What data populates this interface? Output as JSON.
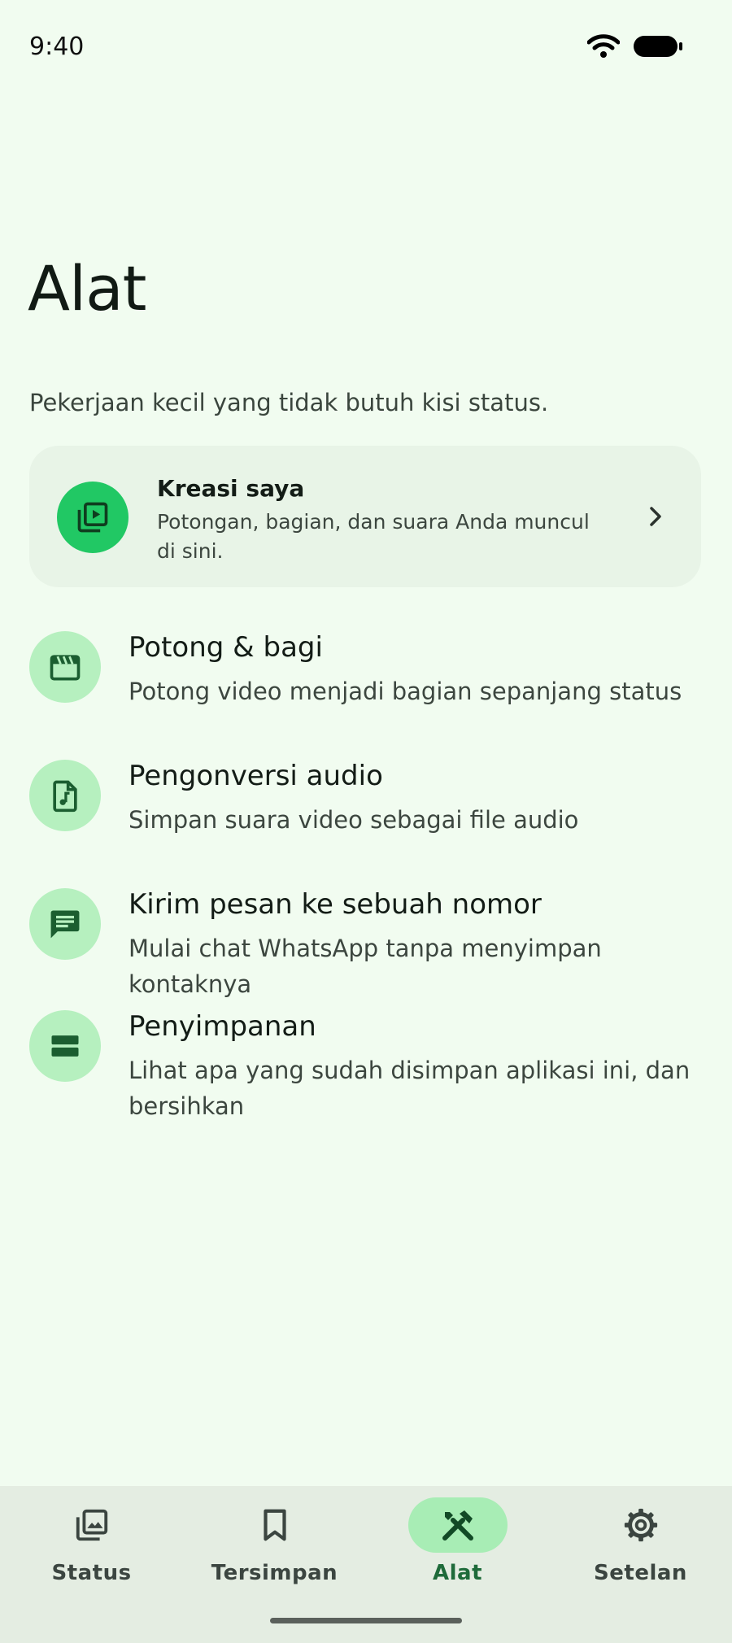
{
  "status_bar": {
    "time": "9:40",
    "icons": [
      "wifi-icon",
      "battery-icon"
    ]
  },
  "page": {
    "title": "Alat",
    "subtitle": "Pekerjaan kecil yang tidak butuh kisi status."
  },
  "featured": {
    "title": "Kreasi saya",
    "description": "Potongan, bagian, dan suara Anda muncul di sini.",
    "icon": "video-library-icon",
    "accent_color": "#21c864"
  },
  "tools": [
    {
      "title": "Potong & bagi",
      "description": "Potong video menjadi bagian sepanjang status",
      "icon": "clapperboard-icon"
    },
    {
      "title": "Pengonversi audio",
      "description": "Simpan suara video sebagai file audio",
      "icon": "audio-file-icon"
    },
    {
      "title": "Kirim pesan ke sebuah nomor",
      "description": "Mulai chat WhatsApp tanpa menyimpan kontaknya",
      "icon": "message-icon"
    },
    {
      "title": "Penyimpanan",
      "description": "Lihat apa yang sudah disimpan aplikasi ini, dan bersihkan",
      "icon": "storage-icon"
    }
  ],
  "bottom_nav": {
    "items": [
      {
        "label": "Status",
        "icon": "gallery-icon",
        "active": false
      },
      {
        "label": "Tersimpan",
        "icon": "bookmark-icon",
        "active": false
      },
      {
        "label": "Alat",
        "icon": "tools-icon",
        "active": true
      },
      {
        "label": "Setelan",
        "icon": "gear-icon",
        "active": false
      }
    ],
    "active_color": "#a8edb5"
  },
  "colors": {
    "background": "#f1fcf0",
    "icon_circle": "#b6f0bf",
    "icon_foreground": "#1b5e30"
  }
}
